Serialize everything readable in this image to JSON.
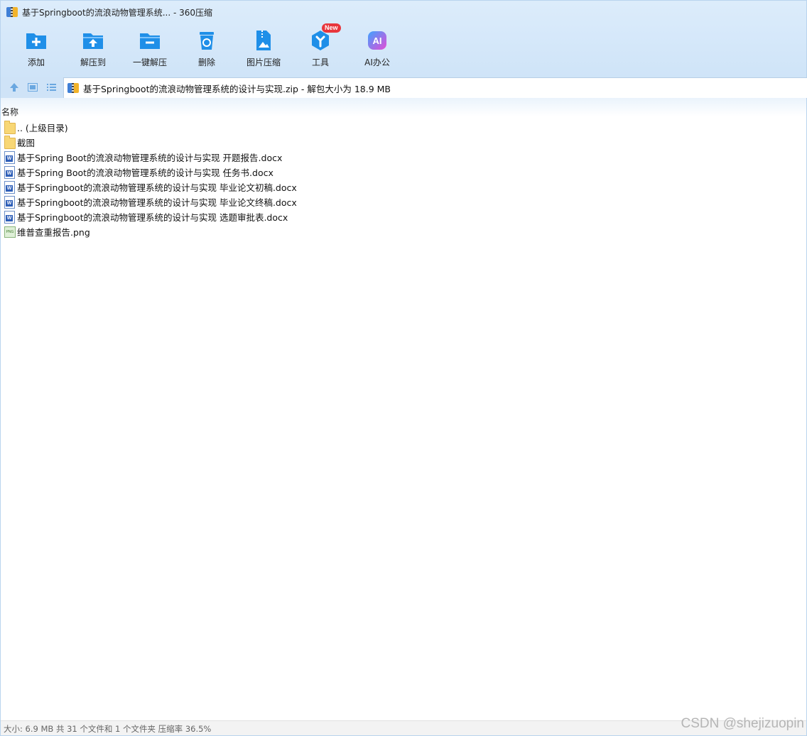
{
  "window": {
    "title": "基于Springboot的流浪动物管理系统... - 360压缩"
  },
  "toolbar": {
    "buttons": [
      {
        "label": "添加",
        "icon": "add-icon"
      },
      {
        "label": "解压到",
        "icon": "extract-to-icon"
      },
      {
        "label": "一键解压",
        "icon": "one-click-extract-icon"
      },
      {
        "label": "删除",
        "icon": "delete-icon"
      },
      {
        "label": "图片压缩",
        "icon": "image-compress-icon"
      },
      {
        "label": "工具",
        "icon": "tools-icon"
      },
      {
        "label": "AI办公",
        "icon": "ai-office-icon"
      }
    ],
    "new_badge": "New",
    "ai_icon_text": "AI"
  },
  "address": {
    "text": "基于Springboot的流浪动物管理系统的设计与实现.zip - 解包大小为 18.9 MB"
  },
  "list": {
    "column_name": "名称",
    "files": [
      {
        "name": ".. (上级目录)",
        "type": "folder"
      },
      {
        "name": "截图",
        "type": "folder"
      },
      {
        "name": "基于Spring Boot的流浪动物管理系统的设计与实现 开题报告.docx",
        "type": "docx"
      },
      {
        "name": "基于Spring Boot的流浪动物管理系统的设计与实现 任务书.docx",
        "type": "docx"
      },
      {
        "name": "基于Springboot的流浪动物管理系统的设计与实现 毕业论文初稿.docx",
        "type": "docx"
      },
      {
        "name": "基于Springboot的流浪动物管理系统的设计与实现 毕业论文终稿.docx",
        "type": "docx"
      },
      {
        "name": "基于Springboot的流浪动物管理系统的设计与实现 选题审批表.docx",
        "type": "docx"
      },
      {
        "name": "维普查重报告.png",
        "type": "png"
      }
    ]
  },
  "status": {
    "text": "大小: 6.9 MB 共 31 个文件和 1 个文件夹 压缩率 36.5%"
  },
  "watermark": "CSDN @shejizuopin",
  "colors": {
    "accent": "#1f8fe8",
    "toolbar_bg": "#d6e8fa"
  }
}
